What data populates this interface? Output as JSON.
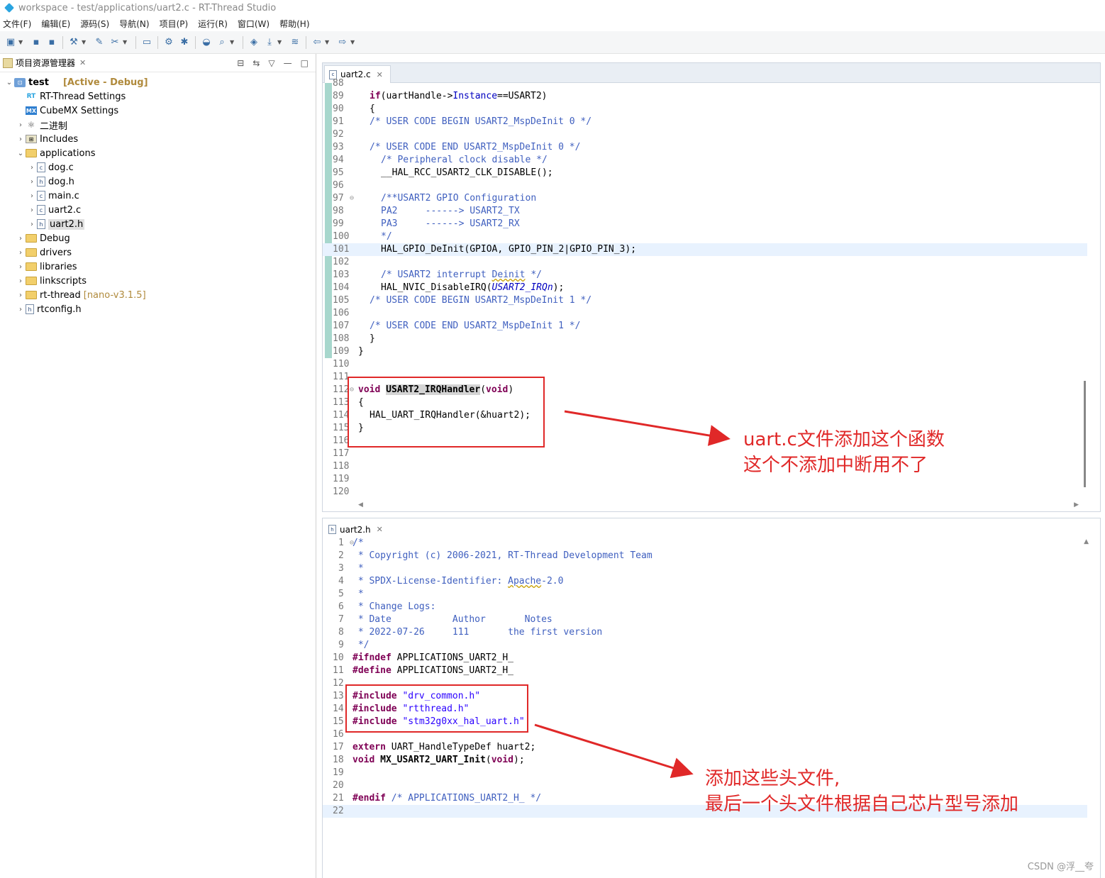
{
  "window": {
    "title": "workspace - test/applications/uart2.c - RT-Thread Studio"
  },
  "menu": [
    "文件(F)",
    "编辑(E)",
    "源码(S)",
    "导航(N)",
    "项目(P)",
    "运行(R)",
    "窗口(W)",
    "帮助(H)"
  ],
  "project_explorer": {
    "tab_label": "项目资源管理器",
    "items": [
      {
        "label": "test",
        "tag": "[Active - Debug]"
      },
      {
        "label": "RT-Thread Settings"
      },
      {
        "label": "CubeMX Settings"
      },
      {
        "label": "二进制"
      },
      {
        "label": "Includes"
      },
      {
        "label": "applications"
      },
      {
        "label": "dog.c"
      },
      {
        "label": "dog.h"
      },
      {
        "label": "main.c"
      },
      {
        "label": "uart2.c"
      },
      {
        "label": "uart2.h"
      },
      {
        "label": "Debug"
      },
      {
        "label": "drivers"
      },
      {
        "label": "libraries"
      },
      {
        "label": "linkscripts"
      },
      {
        "label": "rt-thread",
        "tag": "[nano-v3.1.5]"
      },
      {
        "label": "rtconfig.h"
      }
    ]
  },
  "editor_top": {
    "tab": "uart2.c",
    "line_numbers": [
      "88",
      "89",
      "90",
      "91",
      "92",
      "93",
      "94",
      "95",
      "96",
      "97",
      "98",
      "99",
      "100",
      "101",
      "102",
      "103",
      "104",
      "105",
      "106",
      "107",
      "108",
      "109",
      "110",
      "111",
      "112",
      "113",
      "114",
      "115",
      "116",
      "117",
      "118",
      "119",
      "120"
    ]
  },
  "editor_bottom": {
    "tab": "uart2.h",
    "line_numbers": [
      "1",
      "2",
      "3",
      "4",
      "5",
      "6",
      "7",
      "8",
      "9",
      "10",
      "11",
      "12",
      "13",
      "14",
      "15",
      "16",
      "17",
      "18",
      "19",
      "20",
      "21",
      "22"
    ]
  },
  "annotations": {
    "top_line1": "uart.c文件添加这个函数",
    "top_line2": "这个不添加中断用不了",
    "bottom_line1": "添加这些头文件,",
    "bottom_line2": "最后一个头文件根据自己芯片型号添加"
  },
  "watermark": "CSDN @浮__夸",
  "colors": {
    "annotation_red": "#e02828",
    "keyword": "#7f0055",
    "comment": "#3f5fbf",
    "string": "#2a00ff"
  }
}
